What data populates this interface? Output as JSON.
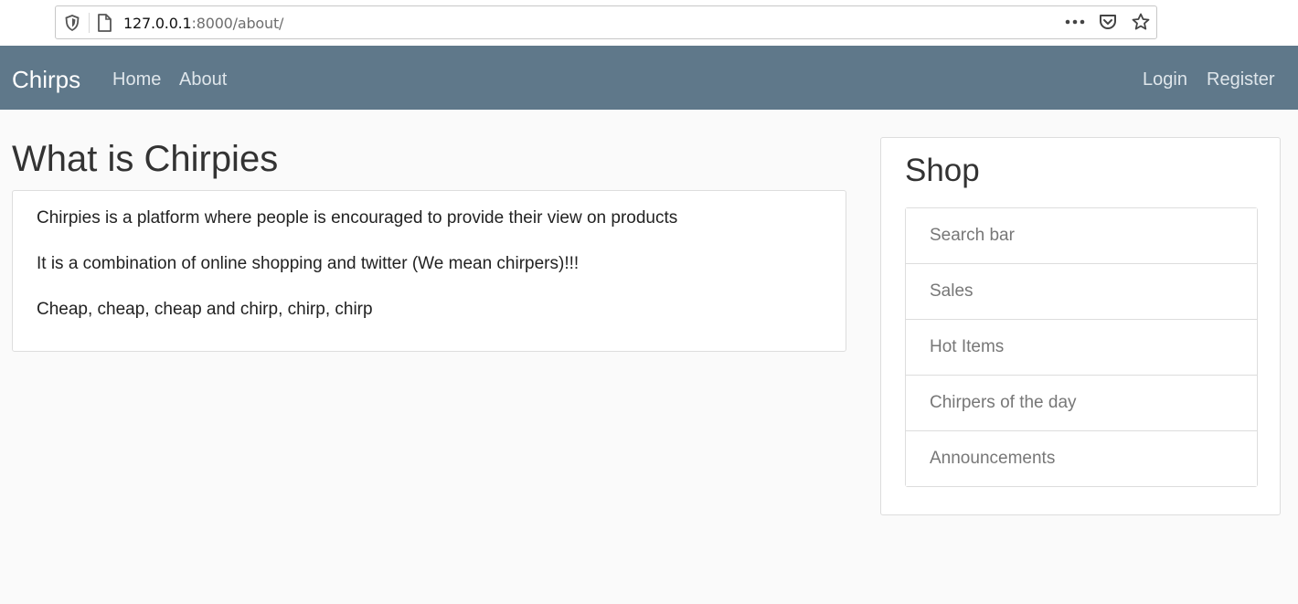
{
  "browser": {
    "url_host": "127.0.0.1",
    "url_rest": ":8000/about/",
    "icons": [
      "shield-icon",
      "page-icon",
      "more-icon",
      "pocket-icon",
      "star-icon"
    ]
  },
  "navbar": {
    "brand": "Chirps",
    "left_links": [
      "Home",
      "About"
    ],
    "right_links": [
      "Login",
      "Register"
    ],
    "bg_color": "#5f788a"
  },
  "main": {
    "title": "What is Chirpies",
    "paragraphs": [
      "Chirpies is a platform where people is encouraged to provide their view on products",
      "It is a combination of online shopping and twitter (We mean chirpers)!!!",
      "Cheap, cheap, cheap and chirp, chirp, chirp"
    ]
  },
  "sidebar": {
    "title": "Shop",
    "items": [
      "Search bar",
      "Sales",
      "Hot Items",
      "Chirpers of the day",
      "Announcements"
    ]
  }
}
